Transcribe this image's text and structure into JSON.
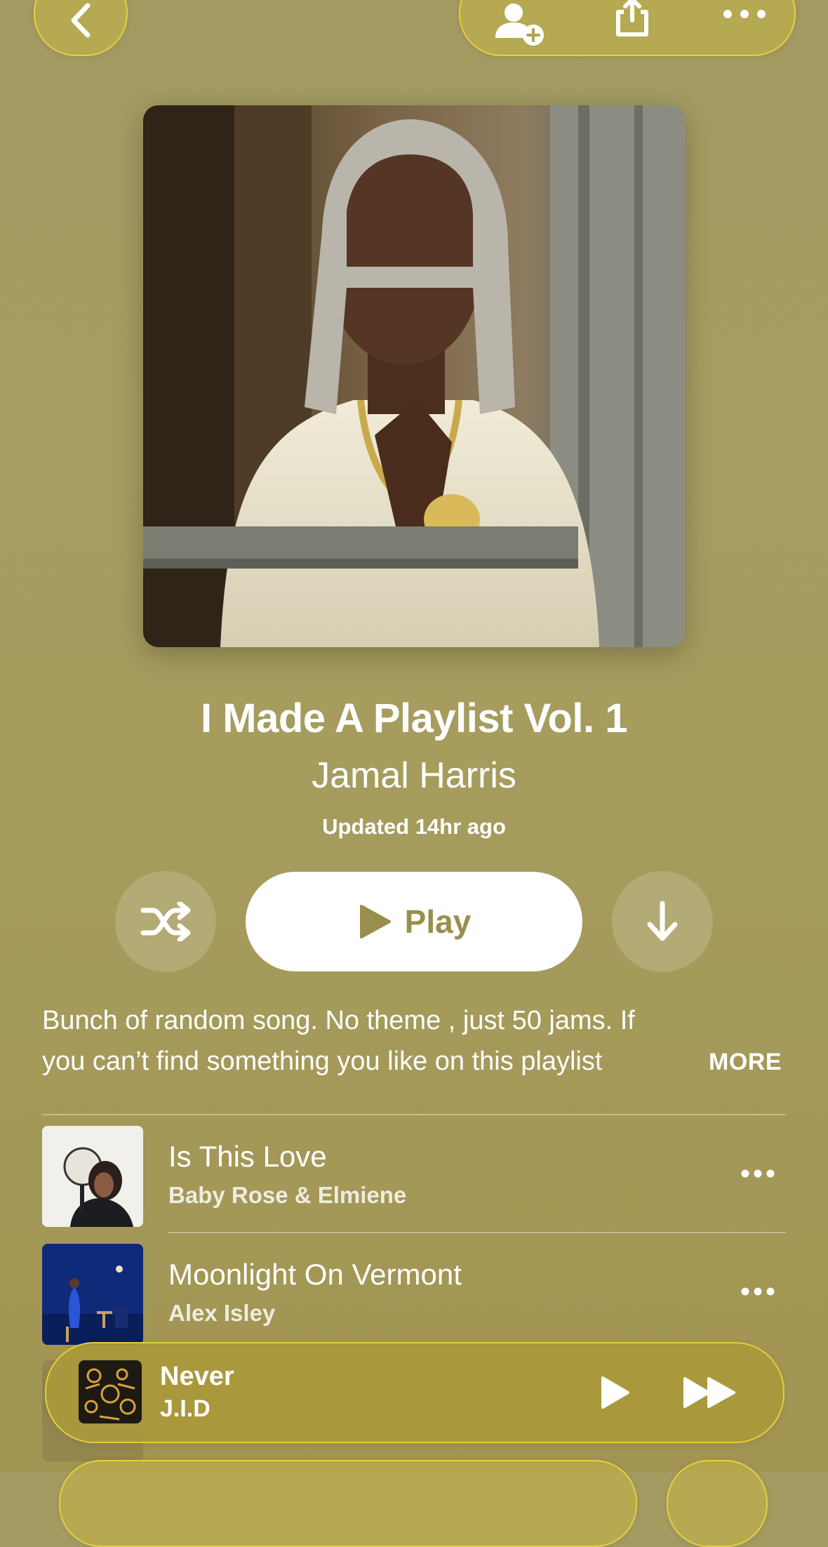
{
  "playlist": {
    "title": "I Made A Playlist Vol. 1",
    "artist": "Jamal Harris",
    "updated": "Updated 14hr ago",
    "description_line1": "Bunch of random song. No theme , just 50 jams. If",
    "description_line2": "you can’t find something you like on this playlist",
    "more_label": "MORE"
  },
  "controls": {
    "play_label": "Play"
  },
  "tracks": [
    {
      "title": "Is This Love",
      "artist": "Baby Rose & Elmiene"
    },
    {
      "title": "Moonlight On Vermont",
      "artist": "Alex Isley"
    }
  ],
  "now_playing": {
    "title": "Never",
    "artist": "J.I.D"
  },
  "icons": {
    "back": "chevron-left-icon",
    "add_user": "person-add-icon",
    "share": "share-icon",
    "more": "ellipsis-icon",
    "shuffle": "shuffle-icon",
    "download": "arrow-down-icon",
    "play": "play-icon",
    "forward": "fast-forward-icon"
  },
  "colors": {
    "background": "#a59b5c",
    "accent_border": "#ebd43c",
    "play_text": "#9a8e4d"
  }
}
